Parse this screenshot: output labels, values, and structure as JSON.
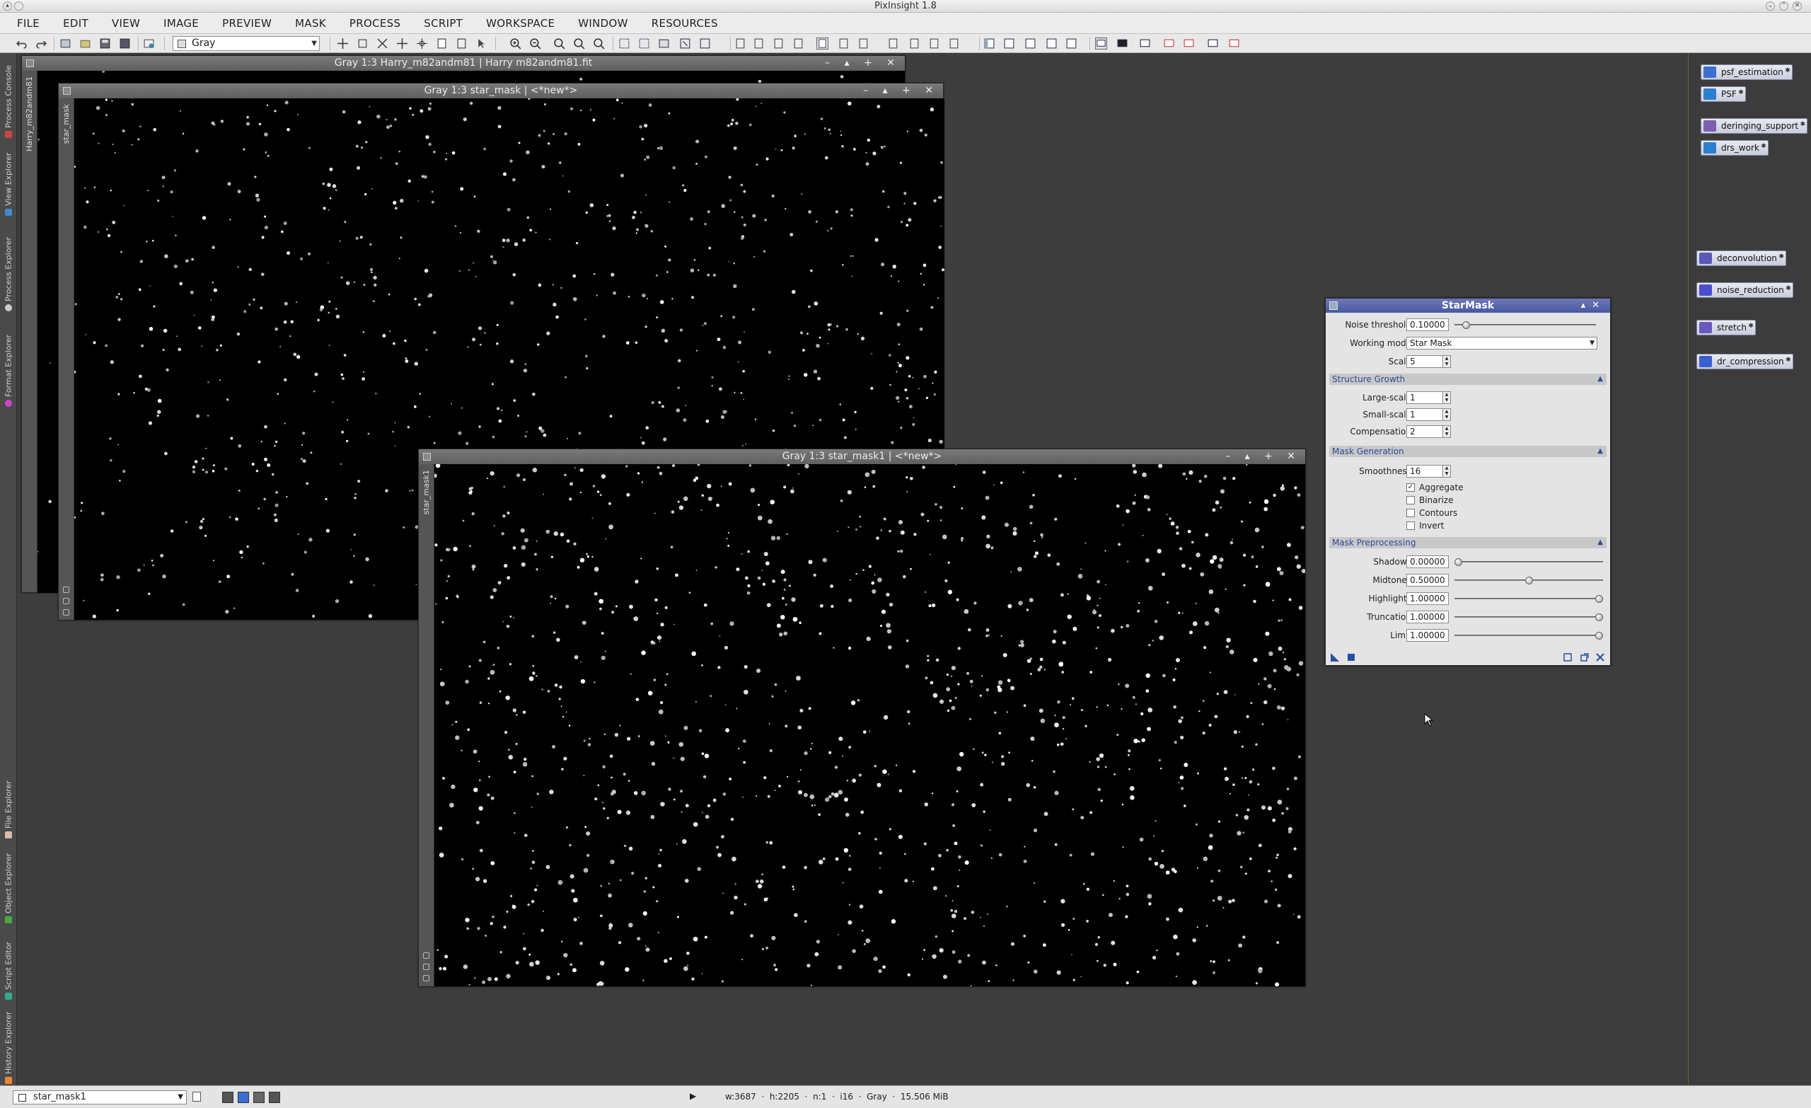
{
  "app": {
    "title": "PixInsight 1.8"
  },
  "menu": [
    "FILE",
    "EDIT",
    "VIEW",
    "IMAGE",
    "PREVIEW",
    "MASK",
    "PROCESS",
    "SCRIPT",
    "WORKSPACE",
    "WINDOW",
    "RESOURCES"
  ],
  "toolbar": {
    "display_mode": "Gray"
  },
  "left_tabs": [
    "Process Console",
    "View Explorer",
    "Process Explorer",
    "Format Explorer",
    "File Explorer",
    "Object Explorer",
    "Script Editor",
    "History Explorer"
  ],
  "windows": {
    "harry": {
      "title": "Gray 1:3 Harry_m82andm81 | Harry m82andm81.fit",
      "side_label": "Harry_m82andm81"
    },
    "star_mask": {
      "title": "Gray 1:3 star_mask | <*new*>",
      "side_label": "star_mask"
    },
    "star_mask1": {
      "title": "Gray 1:3 star_mask1 | <*new*>",
      "side_label": "star_mask1"
    }
  },
  "icons": [
    "psf_estimation",
    "PSF",
    "deringing_support",
    "drs_work",
    "deconvolution",
    "noise_reduction",
    "stretch",
    "dr_compression"
  ],
  "starmask": {
    "title": "StarMask",
    "noise_threshold": {
      "label": "Noise threshold:",
      "value": "0.10000",
      "fraction": 0.06
    },
    "working_mode": {
      "label": "Working mode:",
      "value": "Star Mask"
    },
    "scale": {
      "label": "Scale:",
      "value": "5"
    },
    "structure_growth": {
      "title": "Structure Growth",
      "large": {
        "label": "Large-scale:",
        "value": "1"
      },
      "small": {
        "label": "Small-scale:",
        "value": "1"
      },
      "comp": {
        "label": "Compensation:",
        "value": "2"
      }
    },
    "mask_generation": {
      "title": "Mask Generation",
      "smooth": {
        "label": "Smoothness:",
        "value": "16"
      },
      "aggregate": {
        "label": "Aggregate",
        "checked": true
      },
      "binarize": {
        "label": "Binarize",
        "checked": false
      },
      "contours": {
        "label": "Contours",
        "checked": false
      },
      "invert": {
        "label": "Invert",
        "checked": false
      }
    },
    "mask_preprocessing": {
      "title": "Mask Preprocessing",
      "shadows": {
        "label": "Shadows:",
        "value": "0.00000",
        "fraction": 0.0
      },
      "midtones": {
        "label": "Midtones:",
        "value": "0.50000",
        "fraction": 0.5
      },
      "highlights": {
        "label": "Highlights:",
        "value": "1.00000",
        "fraction": 1.0
      },
      "truncation": {
        "label": "Truncation:",
        "value": "1.00000",
        "fraction": 1.0
      },
      "limit": {
        "label": "Limit:",
        "value": "1.00000",
        "fraction": 1.0
      }
    }
  },
  "status": {
    "view": "star_mask1",
    "info": "w:3687  ·  h:2205  ·  n:1  ·  i16  ·  Gray  ·  15.506 MiB"
  },
  "colors": {
    "titlebar_accent": "#5060a8",
    "workspace_bg": "#3d3d3d"
  }
}
